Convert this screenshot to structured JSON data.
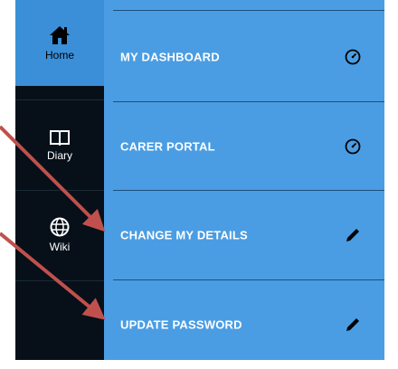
{
  "nav": {
    "items": [
      {
        "label": "Home",
        "icon": "home-icon",
        "active": true
      },
      {
        "label": "Diary",
        "icon": "book-icon",
        "active": false
      },
      {
        "label": "Wiki",
        "icon": "globe-icon",
        "active": false
      }
    ]
  },
  "menu": {
    "items": [
      {
        "label": "MY DASHBOARD",
        "icon": "dashboard-icon"
      },
      {
        "label": "CARER PORTAL",
        "icon": "dashboard-icon"
      },
      {
        "label": "CHANGE MY DETAILS",
        "icon": "pencil-icon"
      },
      {
        "label": "UPDATE PASSWORD",
        "icon": "pencil-icon"
      }
    ]
  },
  "colors": {
    "rail_bg": "#071019",
    "active_bg": "#3a8fd8",
    "panel_bg": "#4a9de3",
    "arrow": "#c0504d"
  }
}
